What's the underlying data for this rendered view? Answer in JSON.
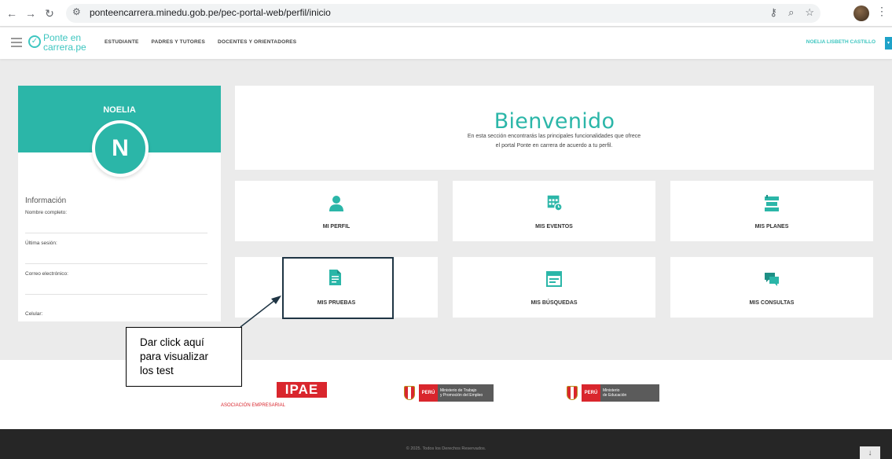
{
  "browser": {
    "url": "ponteencarrera.minedu.gob.pe/pec-portal-web/perfil/inicio",
    "back_icon": "arrow-left-icon",
    "forward_icon": "arrow-right-icon",
    "reload_icon": "reload-icon"
  },
  "header": {
    "logo_line1": "Ponte en",
    "logo_line2": "carrera.pe",
    "nav": [
      "ESTUDIANTE",
      "PADRES Y TUTORES",
      "DOCENTES Y ORIENTADORES"
    ],
    "user_name": "NOELIA LISBETH CASTILLO"
  },
  "profile": {
    "name": "NOELIA",
    "initial": "N",
    "info_title": "Información",
    "fields": [
      "Nombre completo:",
      "Última sesión:",
      "Correo electrónico:",
      "Celular:"
    ]
  },
  "welcome": {
    "title": "Bienvenido",
    "line1": "En esta sección encontrarás las principales funcionalidades que ofrece",
    "line2": "el portal Ponte en carrera de acuerdo a tu perfil."
  },
  "tiles": [
    {
      "label": "MI PERFIL",
      "icon": "user-icon"
    },
    {
      "label": "MIS EVENTOS",
      "icon": "calendar-icon"
    },
    {
      "label": "MIS PLANES",
      "icon": "plans-icon"
    },
    {
      "label": "MIS PRUEBAS",
      "icon": "document-icon"
    },
    {
      "label": "MIS BÚSQUEDAS",
      "icon": "search-window-icon"
    },
    {
      "label": "MIS CONSULTAS",
      "icon": "chat-icon"
    }
  ],
  "annotation": {
    "line1": "Dar click aquí",
    "line2": "para visualizar",
    "line3": "los test"
  },
  "footer": {
    "ipae": "IPAE",
    "ipae_sub": "ASOCIACIÓN EMPRESARIAL",
    "peru": "PERÚ",
    "ministry1_a": "Ministerio de Trabajo",
    "ministry1_b": "y Promoción del Empleo",
    "ministry2_a": "Ministerio",
    "ministry2_b": "de Educación",
    "copyright": "© 2025. Todos los Derechos Reservados."
  },
  "colors": {
    "brand_teal": "#2bb6a8",
    "annotation_border": "#1f3544",
    "footer_bg": "#262626"
  }
}
